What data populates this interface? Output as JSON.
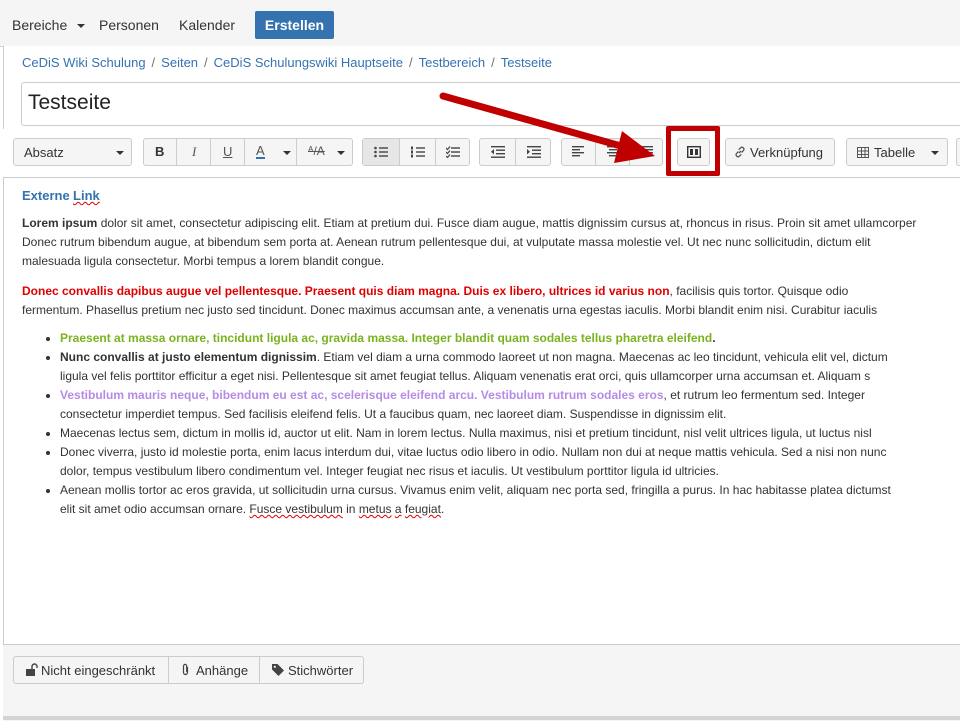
{
  "topnav": {
    "items": [
      "Bereiche",
      "Personen",
      "Kalender"
    ],
    "create_label": "Erstellen"
  },
  "breadcrumb": [
    "CeDiS Wiki Schulung",
    "Seiten",
    "CeDiS Schulungswiki Hauptseite",
    "Testbereich",
    "Testseite"
  ],
  "breadcrumb_separator": "/",
  "page_title": "Testseite",
  "toolbar": {
    "paragraph_style": "Absatz",
    "bold": "B",
    "italic": "I",
    "underline": "U",
    "text_color": "A",
    "more_format": "ᴬ/A",
    "link_label": "Verknüpfung",
    "table_label": "Tabelle"
  },
  "content": {
    "heading": {
      "w1": "Externe",
      "w2": "Link"
    },
    "p1": {
      "bold": "Lorem ipsum",
      "l1": " dolor sit amet, consectetur adipiscing elit. Etiam at pretium dui. Fusce diam augue, mattis dignissim cursus at, rhoncus in risus. Proin sit amet ullamcorper",
      "l2": "Donec rutrum bibendum augue, at bibendum sem porta at. Aenean rutrum pellentesque dui, at vulputate massa molestie vel. Ut nec nunc sollicitudin, dictum elit",
      "l3": "malesuada ligula consectetur. Morbi tempus a lorem blandit congue."
    },
    "p2": {
      "red": "Donec convallis dapibus augue vel pellentesque. Praesent quis diam magna. Duis ex libero, ultrices id varius non",
      "l1": ", facilisis quis tortor. Quisque odio",
      "l2": "fermentum. Phasellus pretium nec justo sed tincidunt. Donec maximus accumsan ante, a venenatis urna egestas iaculis. Morbi blandit enim nisi. Curabitur iaculis"
    },
    "bullets": {
      "b1": {
        "green": "Praesent at massa ornare, tincidunt ligula ac, gravida massa. Integer blandit quam sodales tellus pharetra eleifend",
        "end": "."
      },
      "b2": {
        "bold": " Nunc convallis at justo elementum dignissim",
        "l1": ". Etiam vel diam a urna commodo laoreet ut non magna. Maecenas ac leo tincidunt, vehicula elit vel, dictum",
        "l2": "ligula vel felis porttitor efficitur a eget nisi. Pellentesque sit amet feugiat tellus. Aliquam venenatis erat orci, quis ullamcorper urna accumsan et. Aliquam s"
      },
      "b3": {
        "purple": "Vestibulum mauris neque, bibendum eu est ac, scelerisque eleifend arcu. Vestibulum rutrum sodales eros",
        "l1": ", et rutrum leo fermentum sed. Integer",
        "l2": "consectetur imperdiet tempus. Sed facilisis eleifend felis. Ut a faucibus quam, nec laoreet diam. Suspendisse in dignissim elit."
      },
      "b4": {
        "l1": " Maecenas lectus sem, dictum in mollis id, auctor ut elit. Nam in lorem lectus. Nulla maximus, nisi et pretium tincidunt, nisl velit ultrices ligula, ut luctus nisl"
      },
      "b5": {
        "l1": "Donec viverra, justo id molestie porta, enim lacus interdum dui, vitae luctus odio libero in odio. Nullam non dui at neque mattis vehicula. Sed a nisi non nunc",
        "l2": "dolor, tempus vestibulum libero condimentum vel. Integer feugiat nec risus et iaculis. Ut vestibulum porttitor ligula id ultricies."
      },
      "b6": {
        "l1": "Aenean mollis tortor ac eros gravida, ut sollicitudin urna cursus. Vivamus enim velit, aliquam nec porta sed, fringilla a purus. In hac habitasse platea dictumst",
        "l2a": "elit sit amet odio accumsan ornare. ",
        "l2b": "Fusce vestibulum",
        "l2c": " in ",
        "l2d": "metus",
        "l2e": " ",
        "l2f": "a",
        "l2g": " ",
        "l2h": "feugiat",
        "l2i": "."
      }
    }
  },
  "footer": {
    "restrictions_label": "Nicht eingeschränkt",
    "attachments_label": "Anhänge",
    "labels_label": "Stichwörter"
  },
  "colors": {
    "accent": "#3572b0",
    "heading_link": "#3572b0",
    "red_text": "#e00000",
    "green_text": "#7ab31f",
    "purple_text": "#b68ae6",
    "annotation": "#c00000"
  },
  "icons": [
    "chevron-down-icon",
    "bullet-list-icon",
    "numbered-list-icon",
    "task-list-icon",
    "outdent-icon",
    "indent-icon",
    "align-left-icon",
    "align-center-icon",
    "align-right-icon",
    "page-layout-icon",
    "link-icon",
    "table-icon",
    "lock-open-icon",
    "paperclip-icon",
    "tag-icon",
    "arrow-annotation"
  ]
}
